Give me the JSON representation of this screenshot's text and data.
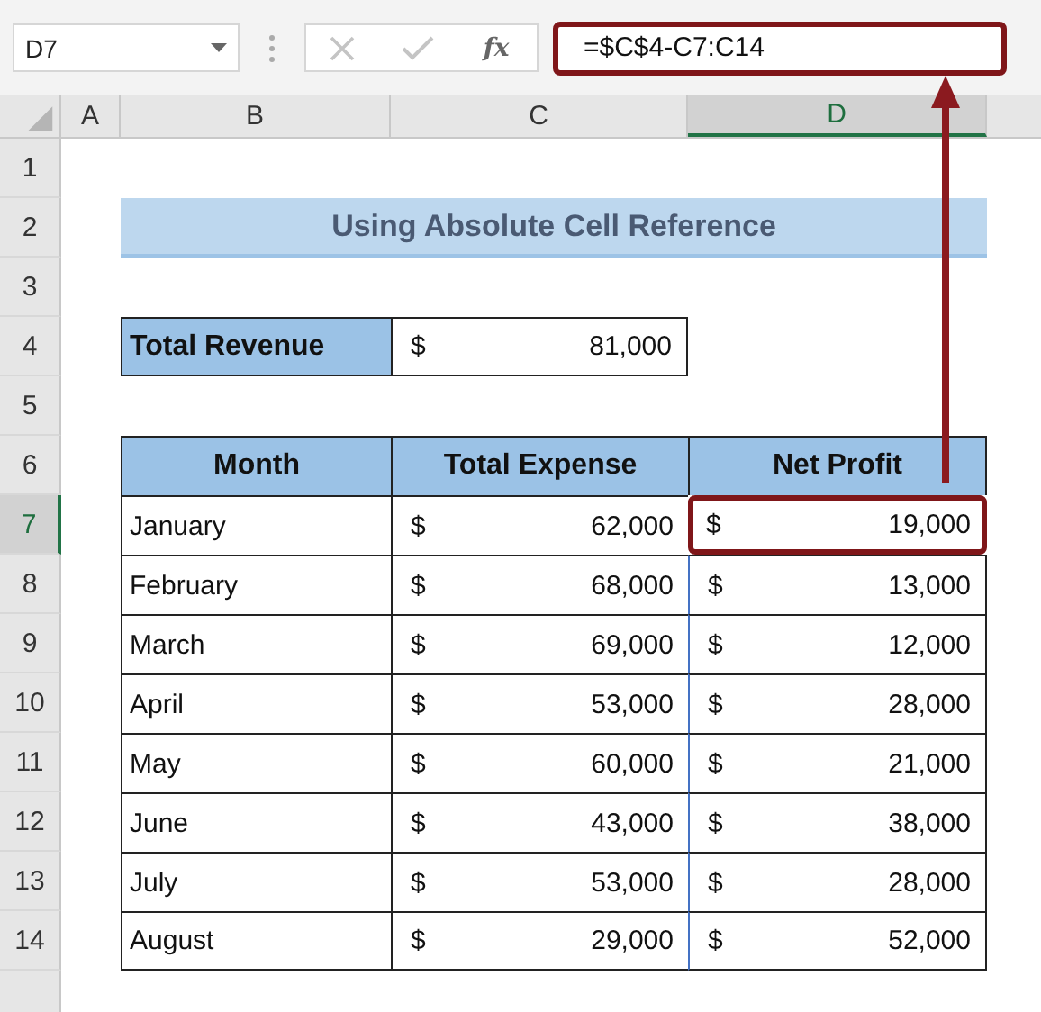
{
  "name_box": {
    "value": "D7"
  },
  "formula_bar": {
    "function_label": "fx",
    "formula": "=$C$4-C7:C14",
    "highlighted": true
  },
  "columns": [
    {
      "label": "A",
      "selected": false
    },
    {
      "label": "B",
      "selected": false
    },
    {
      "label": "C",
      "selected": false
    },
    {
      "label": "D",
      "selected": true
    }
  ],
  "rows": [
    {
      "number": "1",
      "selected": false,
      "kind": "blank"
    },
    {
      "number": "2",
      "selected": false,
      "kind": "title",
      "text": "Using Absolute Cell Reference"
    },
    {
      "number": "3",
      "selected": false,
      "kind": "blank"
    },
    {
      "number": "4",
      "selected": false,
      "kind": "summary",
      "label": "Total Revenue",
      "currency": "$",
      "value": "81,000"
    },
    {
      "number": "5",
      "selected": false,
      "kind": "blank"
    },
    {
      "number": "6",
      "selected": false,
      "kind": "header",
      "cells": [
        "Month",
        "Total Expense",
        "Net Profit"
      ]
    },
    {
      "number": "7",
      "selected": true,
      "kind": "data",
      "month": "January",
      "expense_currency": "$",
      "expense": "62,000",
      "profit_currency": "$",
      "profit": "19,000",
      "profit_active": true
    },
    {
      "number": "8",
      "selected": false,
      "kind": "data",
      "month": "February",
      "expense_currency": "$",
      "expense": "68,000",
      "profit_currency": "$",
      "profit": "13,000",
      "profit_active": false
    },
    {
      "number": "9",
      "selected": false,
      "kind": "data",
      "month": "March",
      "expense_currency": "$",
      "expense": "69,000",
      "profit_currency": "$",
      "profit": "12,000",
      "profit_active": false
    },
    {
      "number": "10",
      "selected": false,
      "kind": "data",
      "month": "April",
      "expense_currency": "$",
      "expense": "53,000",
      "profit_currency": "$",
      "profit": "28,000",
      "profit_active": false
    },
    {
      "number": "11",
      "selected": false,
      "kind": "data",
      "month": "May",
      "expense_currency": "$",
      "expense": "60,000",
      "profit_currency": "$",
      "profit": "21,000",
      "profit_active": false
    },
    {
      "number": "12",
      "selected": false,
      "kind": "data",
      "month": "June",
      "expense_currency": "$",
      "expense": "43,000",
      "profit_currency": "$",
      "profit": "38,000",
      "profit_active": false
    },
    {
      "number": "13",
      "selected": false,
      "kind": "data",
      "month": "July",
      "expense_currency": "$",
      "expense": "53,000",
      "profit_currency": "$",
      "profit": "28,000",
      "profit_active": false
    },
    {
      "number": "14",
      "selected": false,
      "kind": "data",
      "month": "August",
      "expense_currency": "$",
      "expense": "29,000",
      "profit_currency": "$",
      "profit": "52,000",
      "profit_active": false
    }
  ]
}
